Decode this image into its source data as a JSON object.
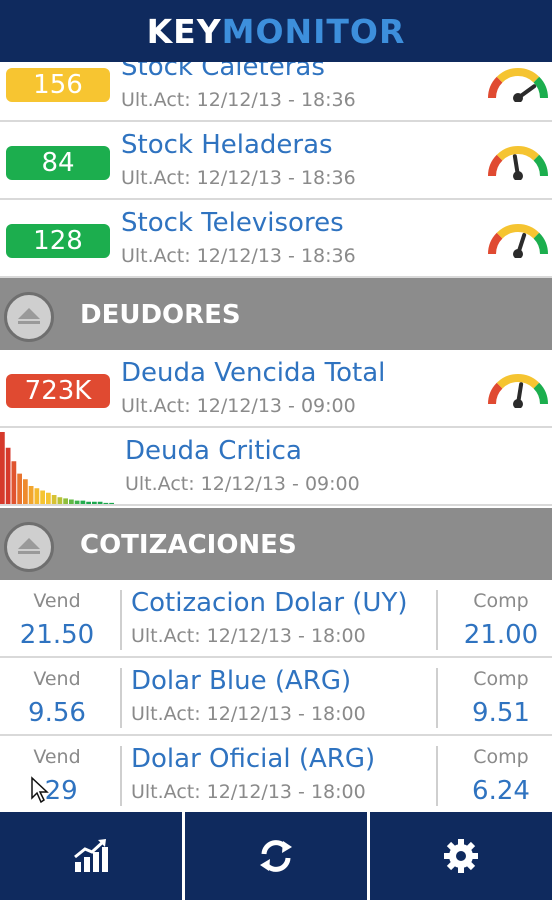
{
  "app": {
    "logo_key": "KEY",
    "logo_monitor": "MONITOR"
  },
  "stock_rows": [
    {
      "badge": "156",
      "badge_color": "yellow",
      "title": "Stock Caleteras",
      "updated": "Ult.Act: 12/12/13 - 18:36",
      "gauge_level": 0.8
    },
    {
      "badge": "84",
      "badge_color": "green",
      "title": "Stock Heladeras",
      "updated": "Ult.Act: 12/12/13 - 18:36",
      "gauge_level": 0.45
    },
    {
      "badge": "128",
      "badge_color": "green",
      "title": "Stock Televisores",
      "updated": "Ult.Act: 12/12/13 - 18:36",
      "gauge_level": 0.6
    }
  ],
  "sections": {
    "deudores": "DEUDORES",
    "cotizaciones": "COTIZACIONES"
  },
  "deudores_rows": [
    {
      "badge": "723K",
      "badge_color": "red",
      "title": "Deuda Vencida Total",
      "updated": "Ult.Act: 12/12/13 - 09:00",
      "gauge_level": 0.55
    },
    {
      "title": "Deuda Critica",
      "updated": "Ult.Act: 12/12/13 - 09:00"
    }
  ],
  "chart_data": {
    "type": "bar",
    "values": [
      64,
      50,
      38,
      27,
      22,
      16,
      14,
      12,
      10,
      8,
      6,
      5,
      4,
      3,
      3,
      2,
      2,
      2,
      1,
      1
    ],
    "colors": [
      "#d63a2c",
      "#d63a2c",
      "#e0542f",
      "#e8742f",
      "#ee8a2e",
      "#f2a52e",
      "#f4b92f",
      "#f5c431",
      "#f5c431",
      "#d7c233",
      "#b8c236",
      "#8fbf3c",
      "#5fb845",
      "#3db34c",
      "#24ad4f",
      "#1ca84e",
      "#1ca84e",
      "#1ca84e",
      "#1ca84e",
      "#1ca84e"
    ]
  },
  "quotes": [
    {
      "vend_label": "Vend",
      "vend": "21.50",
      "title": "Cotizacion Dolar (UY)",
      "updated": "Ult.Act: 12/12/13 - 18:00",
      "comp_label": "Comp",
      "comp": "21.00"
    },
    {
      "vend_label": "Vend",
      "vend": "9.56",
      "title": "Dolar Blue (ARG)",
      "updated": "Ult.Act: 12/12/13 - 18:00",
      "comp_label": "Comp",
      "comp": "9.51"
    },
    {
      "vend_label": "Vend",
      "vend": ".29",
      "title": "Dolar Oficial (ARG)",
      "updated": "Ult.Act: 12/12/13 - 18:00",
      "comp_label": "Comp",
      "comp": "6.24"
    }
  ],
  "footer": {
    "tabs": [
      "chart-icon",
      "refresh-icon",
      "gear-icon"
    ]
  },
  "colors": {
    "navy": "#0f2a5e",
    "accent": "#3d8fdc",
    "title_blue": "#2f73c0",
    "section_gray": "#8c8c8c"
  }
}
